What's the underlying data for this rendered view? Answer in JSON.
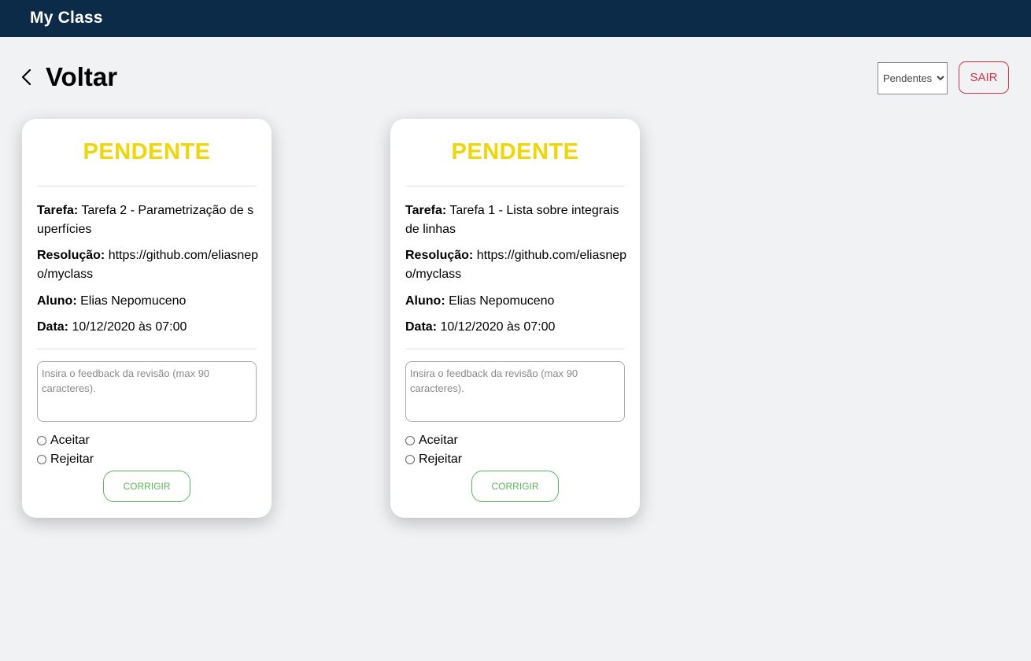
{
  "header": {
    "brand": "My Class"
  },
  "page": {
    "back_label": "Voltar"
  },
  "filter": {
    "selected": "Pendentes",
    "options": [
      "Pendentes"
    ]
  },
  "logout_label": "SAIR",
  "labels": {
    "task": "Tarefa:",
    "resolution": "Resolução:",
    "student": "Aluno:",
    "date": "Data:",
    "accept": "Aceitar",
    "reject": "Rejeitar",
    "feedback_placeholder": "Insira o feedback da revisão (max 90 caracteres).",
    "correct": "CORRIGIR"
  },
  "colors": {
    "pending": "#f2d600",
    "header_bg": "#0b2b48",
    "danger": "#dc3545",
    "success": "#5cb85c"
  },
  "cards": [
    {
      "status": "PENDENTE",
      "task": "Tarefa 2 - Parametrização de superfícies",
      "resolution": "https://github.com/eliasnepo/myclass",
      "student": "Elias Nepomuceno",
      "date": "10/12/2020 às 07:00"
    },
    {
      "status": "PENDENTE",
      "task": "Tarefa 1 - Lista sobre integrais de linhas",
      "resolution": "https://github.com/eliasnepo/myclass",
      "student": "Elias Nepomuceno",
      "date": "10/12/2020 às 07:00"
    }
  ]
}
